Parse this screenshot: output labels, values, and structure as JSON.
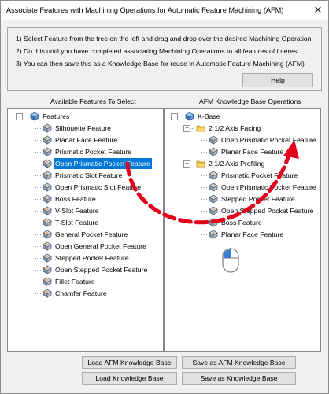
{
  "window": {
    "title": "Associate Features with Machining Operations for Automatic Feature Machining (AFM)",
    "close_glyph": "✕"
  },
  "instructions": {
    "step1": "1)  Select Feature from the tree on the left and drag and drop over the desired Machining Operation",
    "step2": "2)  Do this until you have completed associating Machining Operations to all features of interest",
    "step3": "3)  You can then save this as a Knowledge Base for reuse in Automatic Feature Machining (AFM)",
    "help_label": "Help"
  },
  "left_panel": {
    "label": "Available Features To Select",
    "root": "Features",
    "items": [
      {
        "label": "Silhouette Feature",
        "icon": "silhouette-feature-icon"
      },
      {
        "label": "Planar Face Feature",
        "icon": "planar-face-icon"
      },
      {
        "label": "Prismatic Pocket Feature",
        "icon": "prismatic-pocket-icon"
      },
      {
        "label": "Open Prismatic Pocket Feature",
        "icon": "open-prismatic-pocket-icon",
        "selected": true
      },
      {
        "label": "Prismatic Slot Feature",
        "icon": "prismatic-slot-icon"
      },
      {
        "label": "Open Prismatic Slot Feature",
        "icon": "open-prismatic-slot-icon"
      },
      {
        "label": "Boss Feature",
        "icon": "boss-icon"
      },
      {
        "label": "V-Slot Feature",
        "icon": "v-slot-icon"
      },
      {
        "label": "T-Slot Feature",
        "icon": "t-slot-icon"
      },
      {
        "label": "General Pocket Feature",
        "icon": "general-pocket-icon"
      },
      {
        "label": "Open General Pocket Feature",
        "icon": "open-general-pocket-icon"
      },
      {
        "label": "Stepped Pocket Feature",
        "icon": "stepped-pocket-icon"
      },
      {
        "label": "Open Stepped Pocket Feature",
        "icon": "open-stepped-pocket-icon"
      },
      {
        "label": "Fillet Feature",
        "icon": "fillet-icon"
      },
      {
        "label": "Chamfer Feature",
        "icon": "chamfer-icon"
      }
    ]
  },
  "right_panel": {
    "label": "AFM Knowledge Base Operations",
    "root": "K-Base",
    "groups": [
      {
        "label": "2 1/2 Axis Facing",
        "items": [
          "Open Prismatic Pocket Feature",
          "Planar Face Feature"
        ]
      },
      {
        "label": "2 1/2 Axis Profiling",
        "items": [
          "Prismatic Pocket Feature",
          "Open Prismatic Pocket Feature",
          "Stepped Pocket Feature",
          "Open Stepped Pocket Feature",
          "Boss Feature",
          "Planar Face Feature"
        ]
      }
    ]
  },
  "buttons": {
    "load_afm": "Load AFM Knowledge Base",
    "save_as_afm": "Save as AFM Knowledge Base",
    "load_kb": "Load Knowledge Base",
    "save_as_kb": "Save as Knowledge Base"
  },
  "colors": {
    "selection": "#0078d7",
    "arrow": "#e3001b",
    "folder": "#f5c542"
  }
}
